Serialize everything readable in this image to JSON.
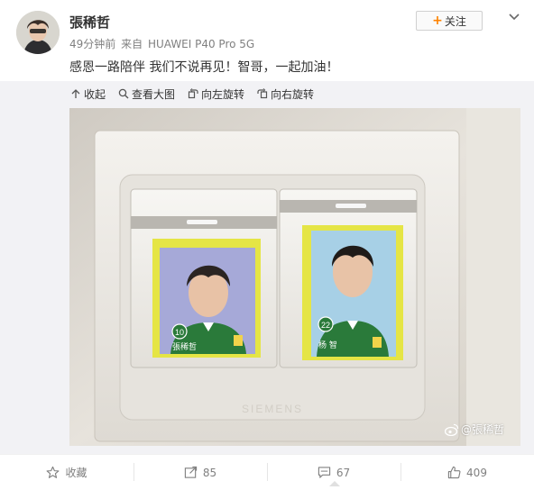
{
  "post": {
    "username": "張稀哲",
    "time": "49分钟前",
    "source_prefix": "来自",
    "device": "HUAWEI P40 Pro 5G",
    "text": "感恩一路陪伴 我们不说再见！智哥，一起加油！"
  },
  "follow": {
    "plus": "+",
    "label": "关注"
  },
  "media_tools": {
    "collapse": "收起",
    "view_large": "查看大图",
    "rotate_left": "向左旋转",
    "rotate_right": "向右旋转"
  },
  "photo": {
    "sticker_left": {
      "number": "10",
      "name": "張稀哲"
    },
    "sticker_right": {
      "number": "22",
      "name": "杨 智"
    },
    "switch_brand": "SIEMENS",
    "watermark": "@張稀哲"
  },
  "actions": {
    "favorite": "收藏",
    "repost_count": "85",
    "comment_count": "67",
    "like_count": "409"
  },
  "colors": {
    "accent": "#ff8200",
    "meta_text": "#808080",
    "media_bg": "#f2f2f5"
  },
  "icons": [
    "chevron-down-icon",
    "collapse-icon",
    "magnifier-icon",
    "rotate-left-icon",
    "rotate-right-icon",
    "weibo-logo-icon",
    "star-icon",
    "repost-icon",
    "comment-icon",
    "thumbs-up-icon"
  ]
}
